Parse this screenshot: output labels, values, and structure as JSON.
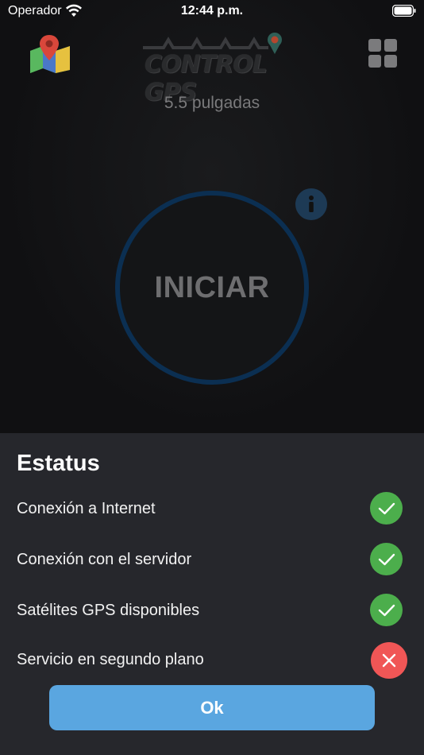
{
  "status_bar": {
    "carrier": "Operador",
    "time": "12:44 p.m.",
    "icons": [
      "wifi-icon",
      "battery-icon"
    ]
  },
  "header": {
    "logo_text": "CONTROL GPS",
    "screen_size": "5.5 pulgadas",
    "icons": [
      "map-icon",
      "grid-icon",
      "info-icon"
    ]
  },
  "main": {
    "start_label": "INICIAR"
  },
  "status_sheet": {
    "title": "Estatus",
    "items": [
      {
        "label": "Conexión a Internet",
        "state": "ok"
      },
      {
        "label": "Conexión con el servidor",
        "state": "ok"
      },
      {
        "label": "Satélites GPS disponibles",
        "state": "ok"
      },
      {
        "label": "Servicio en segundo plano",
        "state": "fail"
      }
    ],
    "ok_label": "Ok"
  },
  "colors": {
    "ok": "#4cae4c",
    "fail": "#f05656",
    "accent": "#5aa6e0",
    "sheet": "#26272c"
  }
}
